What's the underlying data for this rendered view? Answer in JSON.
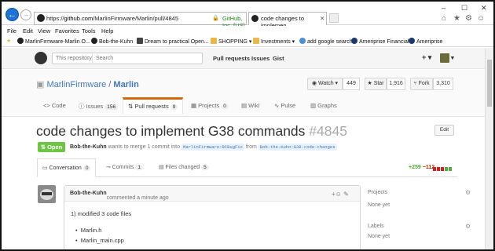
{
  "browser": {
    "url_prefix": "https://",
    "url_host": "github.com",
    "url_path": "/MarlinFirmware/Marlin/pull/4845",
    "lock": "🔒",
    "cert_org": "GitHub, Inc. [US]",
    "tab_title": "code changes to implemen...",
    "window_controls": [
      "–",
      "☐",
      "✕"
    ],
    "right_icons": [
      "⌂",
      "★",
      "⚙",
      "☺"
    ]
  },
  "menubar": [
    "File",
    "Edit",
    "View",
    "Favorites",
    "Tools",
    "Help"
  ],
  "favorites": [
    {
      "label": "MarlinFirmware-Marlin O...",
      "color": "#222222"
    },
    {
      "label": "Bob-the-Kuhn",
      "color": "#222222"
    },
    {
      "label": "Dream to practical  Open...",
      "color": "#444444"
    },
    {
      "label": "SHOPPING ▾",
      "color": "#e8b84a"
    },
    {
      "label": "Investments ▾",
      "color": "#e8b84a"
    },
    {
      "label": "add google search",
      "color": "#4a90d9"
    },
    {
      "label": "Ameriprise Financial",
      "color": "#1a3a6a"
    },
    {
      "label": "Ameriprise",
      "color": "#1a3a6a"
    }
  ],
  "gh_header": {
    "search_scope": "This repository",
    "search_placeholder": "Search",
    "links": [
      "Pull requests",
      "Issues",
      "Gist"
    ],
    "plus": "+ ▾",
    "avatar_caret": "▾"
  },
  "repo": {
    "owner": "MarlinFirmware",
    "sep": " / ",
    "name": "Marlin",
    "watch": "◉ Watch ▾",
    "watch_count": "449",
    "star": "★ Star",
    "star_count": "1,916",
    "fork": "⑂ Fork",
    "fork_count": "3,310",
    "tabs": [
      {
        "label": "<> Code",
        "count": ""
      },
      {
        "label": "ⓘ Issues",
        "count": "156"
      },
      {
        "label": "⇅ Pull requests",
        "count": "9"
      },
      {
        "label": "▦ Projects",
        "count": "0"
      },
      {
        "label": "▤ Wiki",
        "count": ""
      },
      {
        "label": "∿ Pulse",
        "count": ""
      },
      {
        "label": "▥ Graphs",
        "count": ""
      }
    ]
  },
  "pr": {
    "title": "code changes to implement G38 commands",
    "number": "#4845",
    "edit": "Edit",
    "state": "⇅ Open",
    "author": "Bob-the-Kuhn",
    "merge_text": " wants to merge 1 commit into ",
    "base": "MarlinFirmware:RCBugFix",
    "from": " from ",
    "head": "Bob-the-Kuhn:G38-code-changes",
    "tabs": [
      {
        "label": "▭ Conversation",
        "count": "0"
      },
      {
        "label": "⊸ Commits",
        "count": "1"
      },
      {
        "label": "▤ Files changed",
        "count": "5"
      }
    ],
    "additions": "+259",
    "deletions": "−112",
    "diff_colors": [
      "#cc2222",
      "#cc2222",
      "#cc2222",
      "#55aa44",
      "#55aa44"
    ]
  },
  "comment": {
    "author": "Bob-the-Kuhn",
    "meta": " commented a minute ago",
    "actions": "+☺  ✎",
    "line1": "1) modified 3 code files",
    "bullets": [
      "Marlin.h",
      "Marlin_main.cpp"
    ]
  },
  "sidebar": {
    "projects_label": "Projects",
    "projects_value": "None yet",
    "labels_label": "Labels",
    "labels_value": "None yet"
  }
}
